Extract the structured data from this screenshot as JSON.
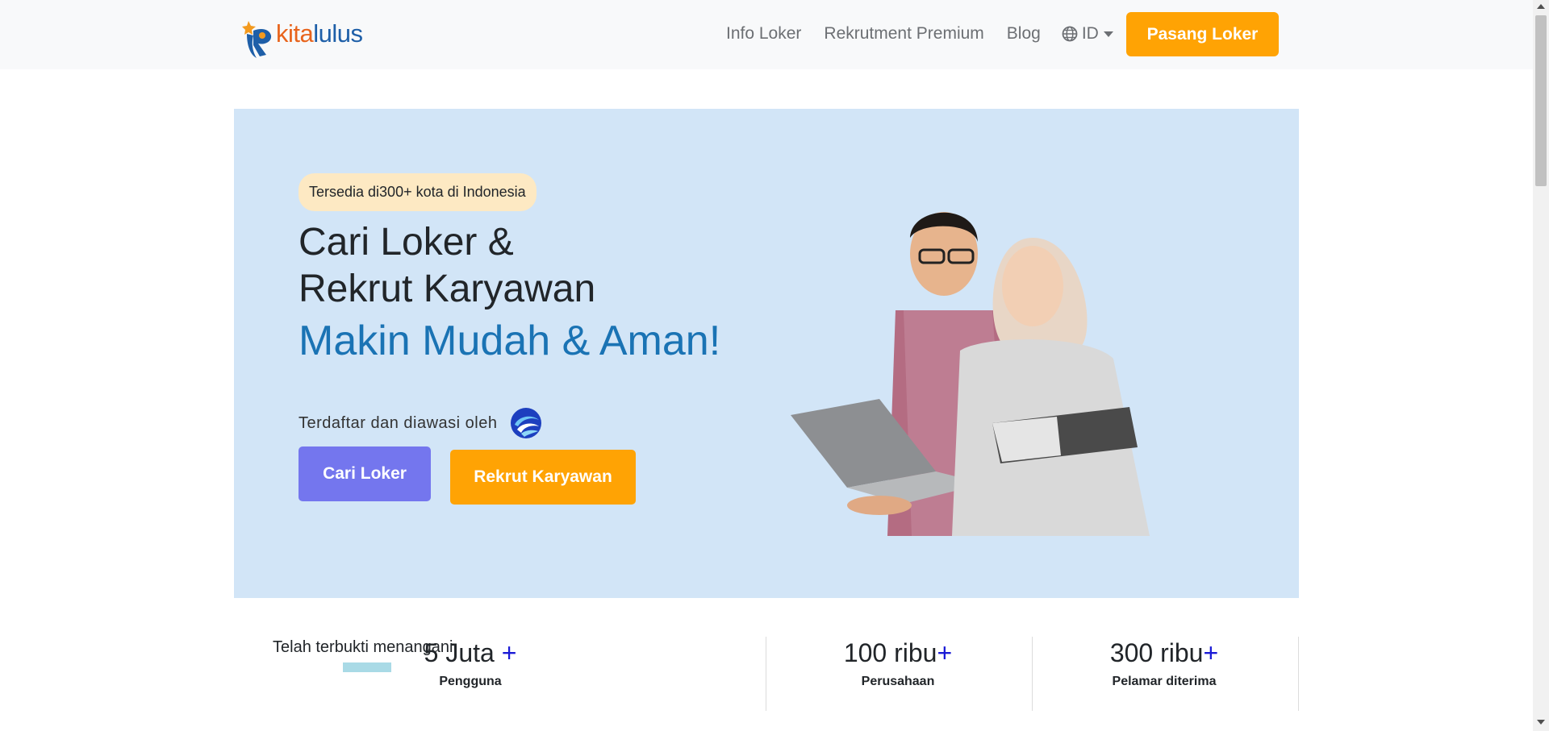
{
  "navbar": {
    "logo_kita": "kita",
    "logo_lulus": "lulus",
    "links": [
      "Info Loker",
      "Rekrutment Premium",
      "Blog"
    ],
    "language": "ID",
    "cta": "Pasang Loker"
  },
  "hero": {
    "badge": "Tersedia di300+ kota di Indonesia",
    "title_line1": "Cari Loker &",
    "title_line2": "Rekrut Karyawan",
    "title_highlight": "Makin Mudah & Aman!",
    "supervised_text": "Terdaftar dan diawasi oleh",
    "btn_find_job": "Cari Loker",
    "btn_recruit": "Rekrut Karyawan"
  },
  "stats": {
    "proven_label": "Telah terbukti menangani",
    "items": [
      {
        "value": "5 Juta ",
        "plus": "+",
        "label": "Pengguna"
      },
      {
        "value": "100 ribu",
        "plus": "+",
        "label": "Perusahaan"
      },
      {
        "value": "300 ribu",
        "plus": "+",
        "label": "Pelamar diterima"
      }
    ]
  },
  "colors": {
    "accent_orange": "#ffa304",
    "accent_purple": "#7476ee",
    "hero_bg": "#d2e5f7",
    "highlight_blue": "#1a73b4"
  }
}
